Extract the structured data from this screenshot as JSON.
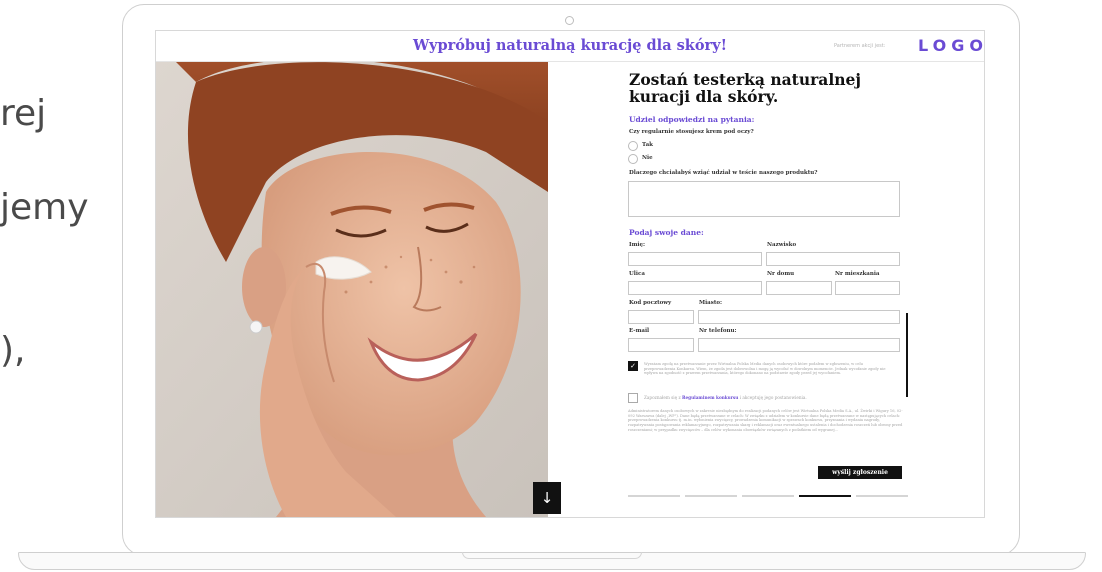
{
  "background": {
    "lines": [
      "rej",
      "jemy",
      "),"
    ]
  },
  "header": {
    "title": "Wypróbuj naturalną kurację dla skóry!",
    "partner_label": "Partnerem akcji jest:",
    "logo": "LOGO"
  },
  "hero": {
    "scroll_button_icon": "arrow-down-icon",
    "scroll_button_glyph": "↓"
  },
  "form": {
    "title": "Zostań testerką naturalnej kuracji dla skóry.",
    "questions_section": "Udziel odpowiedzi na pytania:",
    "question1": "Czy regularnie stosujesz krem pod oczy?",
    "options": [
      "Tak",
      "Nie"
    ],
    "question2": "Dlaczego chciałabyś wziąć udział w teście naszego produktu?",
    "answer2_value": "",
    "data_section": "Podaj swoje dane:",
    "labels": {
      "first_name": "Imię:",
      "last_name": "Nazwisko",
      "street": "Ulica",
      "house_no": "Nr domu",
      "apt_no": "Nr mieszkania",
      "postal": "Kod pocztowy",
      "city": "Miasto:",
      "email": "E-mail",
      "phone": "Nr telefonu:"
    },
    "consent1": "Wyrażam zgodę na przetwarzanie przez Wirtualna Polska Media danych osobowych które podałem w zgłoszeniu, w celu przeprowadzenia Konkursu. Wiem, że zgoda jest dobrowolna i mogę ją wycofać w dowolnym momencie. Jednak wycofanie zgody nie wpływa na zgodność z prawem przetwarzania, którego dokonano na podstawie zgody przed jej wycofaniem.",
    "consent1_checked": true,
    "consent2_prefix": "Zapoznałem się z",
    "consent2_link": "Regulaminem konkursu",
    "consent2_suffix": "i akceptuję jego postanowienia.",
    "consent2_checked": false,
    "legal_text": "Administratorem danych osobowych w zakresie niezbędnym do realizacji podanych celów jest Wirtualna Polska Media S.A., ul. Żwirki i Wigury 16, 02-092 Warszawa (dalej „WP\"). Dane będą przetwarzane w celach: W związku z udziałem w konkursie dane będą przetwarzane w następujących celach: przeprowadzenia konkursu tj. m.in. wyłonienia zwycięzcy, prowadzenia komunikacji w sprawach konkursu, przyznania i wydania nagrody, rozpatrywania postępowania reklamacyjnego, rozpatrywania skarg i reklamacji oraz ewentualnego ustalenia i dochodzenia roszczeń lub obrony przed roszczeniami; w przypadku zwycięzców – dla celów wykonania obowiązków związanych z podatkiem od wygranej...",
    "submit_label": "wyślij zgłoszenie",
    "progress": {
      "steps": 5,
      "active": 4
    }
  }
}
